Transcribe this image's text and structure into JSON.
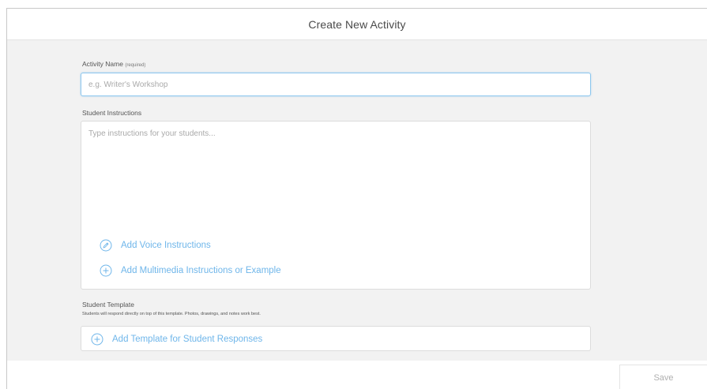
{
  "header": {
    "title": "Create New Activity"
  },
  "activity_name": {
    "label": "Activity Name",
    "required_note": "(required)",
    "placeholder": "e.g. Writer's Workshop",
    "value": ""
  },
  "student_instructions": {
    "label": "Student Instructions",
    "placeholder": "Type instructions for your students...",
    "value": "",
    "add_voice_label": "Add Voice Instructions",
    "add_multimedia_label": "Add Multimedia Instructions or Example"
  },
  "student_template": {
    "label": "Student Template",
    "description": "Students will respond directly on top of this template. Photos, drawings, and notes work best.",
    "add_template_label": "Add Template for Student Responses"
  },
  "footer": {
    "save_label": "Save"
  },
  "colors": {
    "accent": "#6fb6ea",
    "focus_border": "#8ec7ee",
    "panel_bg": "#f2f2f2",
    "disabled_text": "#b0b0b0"
  },
  "icons": {
    "voice": "pencil-circle-icon",
    "multimedia": "plus-circle-icon",
    "template": "plus-circle-icon"
  }
}
